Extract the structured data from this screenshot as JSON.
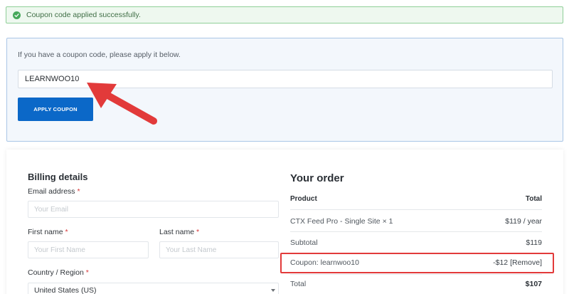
{
  "notice": {
    "message": "Coupon code applied successfully."
  },
  "coupon": {
    "hint": "If you have a coupon code, please apply it below.",
    "code_value": "LEARNWOO10",
    "apply_label": "APPLY COUPON"
  },
  "billing": {
    "title": "Billing details",
    "email_label": "Email address",
    "email_placeholder": "Your Email",
    "first_name_label": "First name",
    "first_name_placeholder": "Your First Name",
    "last_name_label": "Last name",
    "last_name_placeholder": "Your Last Name",
    "country_label": "Country / Region",
    "country_value": "United States (US)",
    "required_mark": "*"
  },
  "order": {
    "title": "Your order",
    "col_product": "Product",
    "col_total": "Total",
    "item_name": "CTX Feed Pro - Single Site",
    "item_qty": "× 1",
    "item_price": "$119 / year",
    "subtotal_label": "Subtotal",
    "subtotal_value": "$119",
    "coupon_label": "Coupon: learnwoo10",
    "coupon_amount": "-$12",
    "coupon_remove": "[Remove]",
    "total_label": "Total",
    "total_value": "$107"
  },
  "colors": {
    "accent": "#0b68c8",
    "success": "#46a85a",
    "annotation": "#e23a3a"
  }
}
